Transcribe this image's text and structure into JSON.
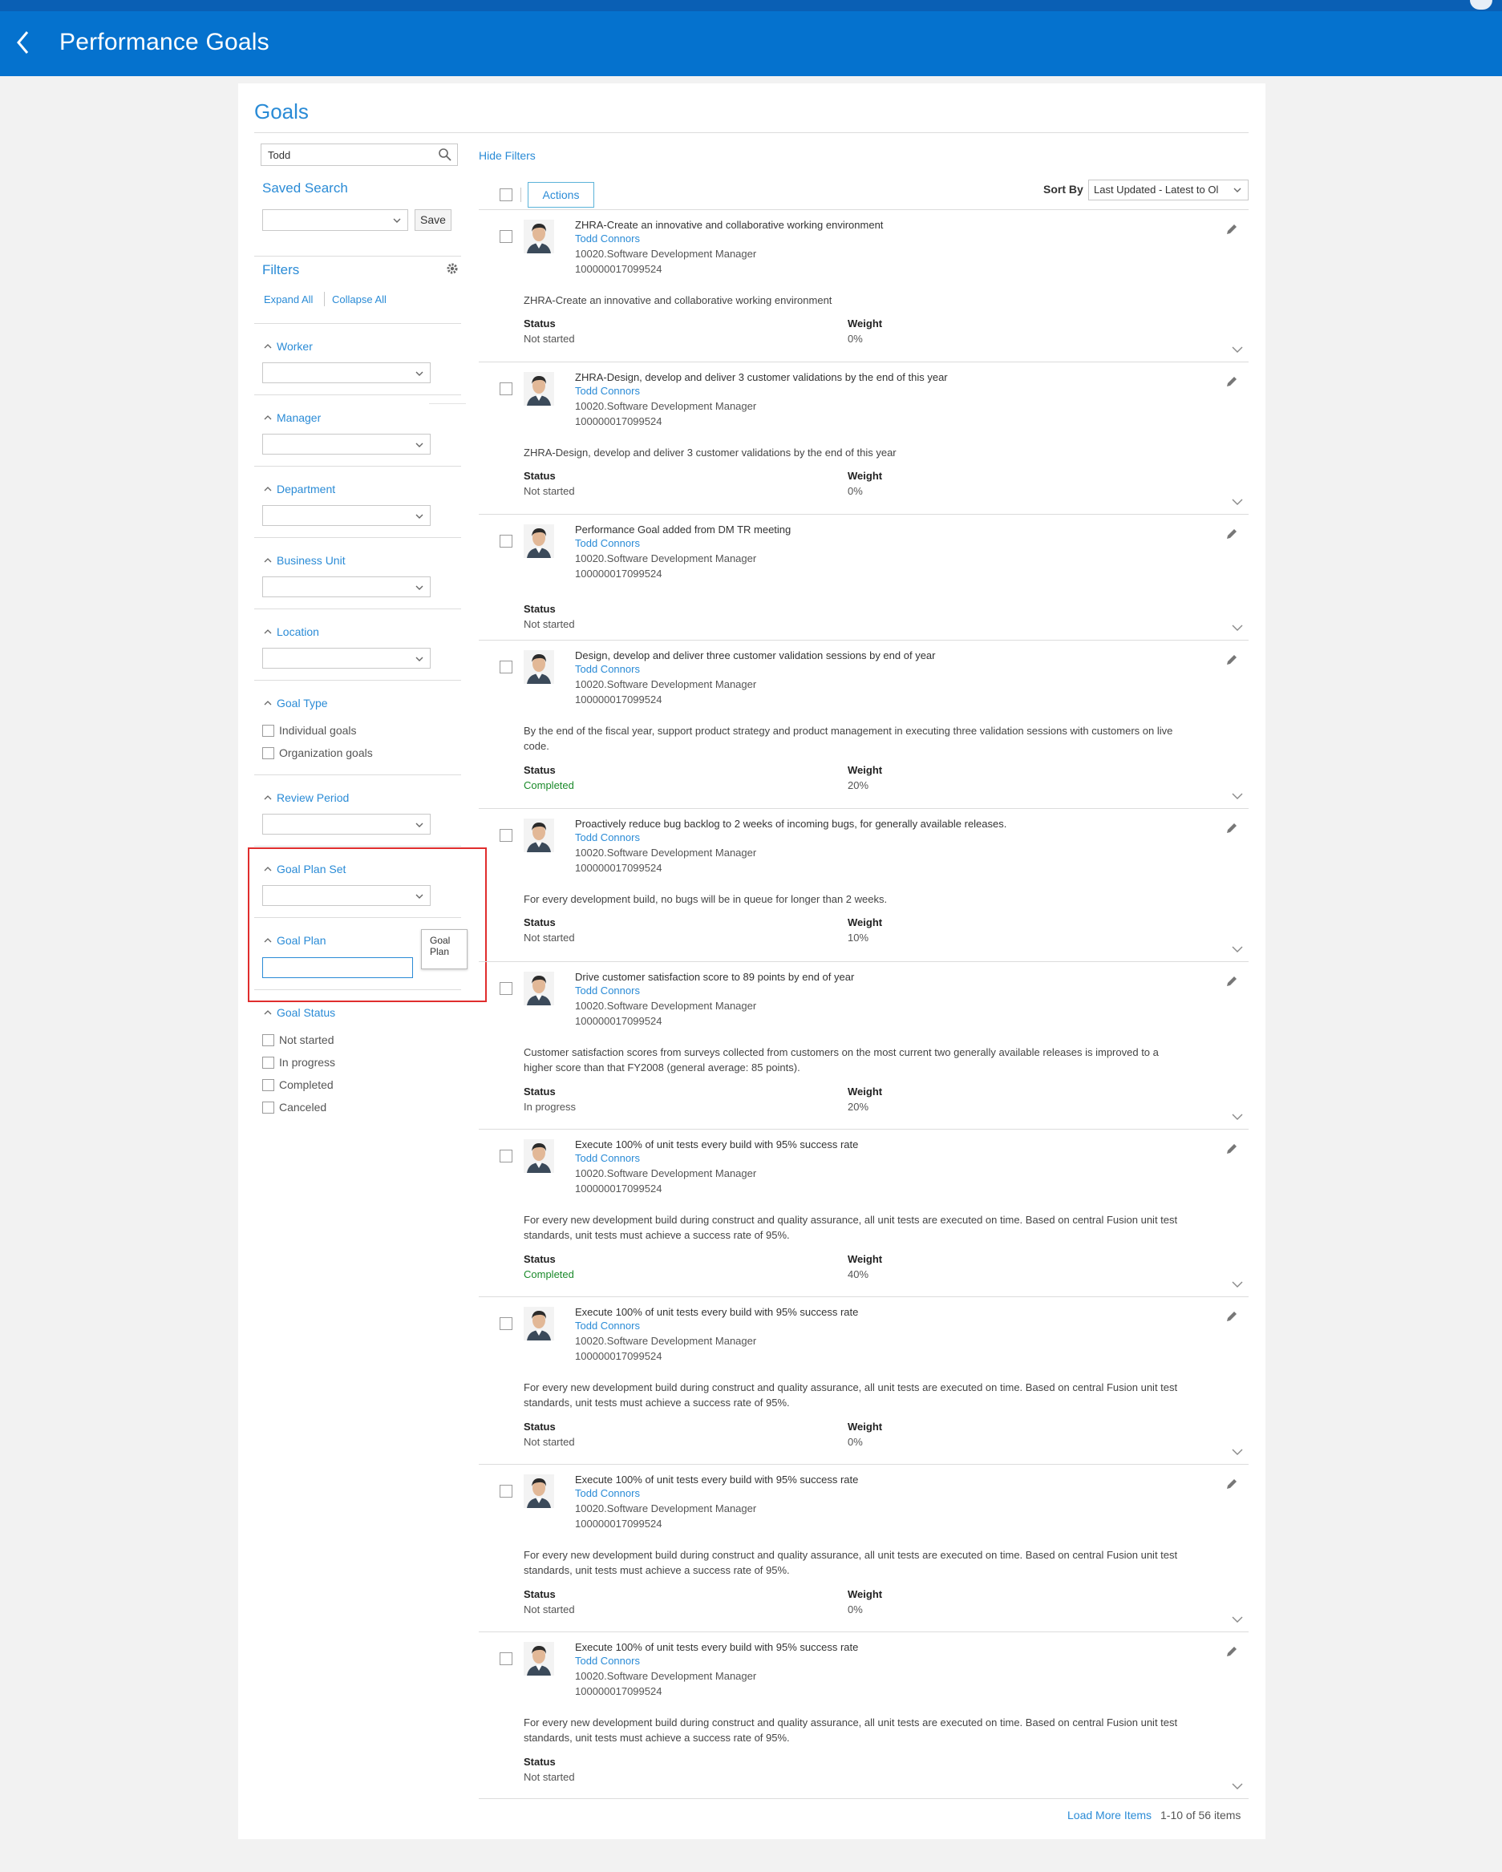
{
  "header": {
    "title": "Performance Goals"
  },
  "panel": {
    "title": "Goals"
  },
  "search": {
    "value": "Todd"
  },
  "saved_search": {
    "title": "Saved Search",
    "save_label": "Save"
  },
  "filters": {
    "title": "Filters",
    "expand_all": "Expand All",
    "collapse_all": "Collapse All",
    "sections": {
      "worker": "Worker",
      "manager": "Manager",
      "department": "Department",
      "business_unit": "Business Unit",
      "location": "Location",
      "goal_type": "Goal Type",
      "review_period": "Review Period",
      "goal_plan_set": "Goal Plan Set",
      "goal_plan": "Goal Plan",
      "goal_status": "Goal Status"
    },
    "goal_type_options": [
      "Individual goals",
      "Organization goals"
    ],
    "goal_status_options": [
      "Not started",
      "In progress",
      "Completed",
      "Canceled"
    ],
    "tooltip": "Goal Plan"
  },
  "results": {
    "hide_filters": "Hide Filters",
    "actions_label": "Actions",
    "sort_by_label": "Sort By",
    "sort_by_value": "Last Updated - Latest to Ol",
    "load_more": "Load More Items",
    "count": "1-10 of 56 items"
  },
  "labels": {
    "status": "Status",
    "weight": "Weight"
  },
  "colors": {
    "header": "#0572ce",
    "link": "#2a8bd6",
    "completed": "#1a8a2a",
    "highlight": "#e02d2d"
  },
  "goals": [
    {
      "title": "ZHRA-Create an innovative and collaborative working environment",
      "worker": "Todd Connors",
      "role": "10020.Software Development Manager",
      "id": "100000017099524",
      "desc": "ZHRA-Create an innovative and collaborative working environment",
      "status": "Not started",
      "weight": "0%"
    },
    {
      "title": "ZHRA-Design, develop and deliver 3 customer validations by the end of this year",
      "worker": "Todd Connors",
      "role": "10020.Software Development Manager",
      "id": "100000017099524",
      "desc": "ZHRA-Design, develop and deliver 3 customer validations by the end of this year",
      "status": "Not started",
      "weight": "0%"
    },
    {
      "title": "Performance Goal added from DM TR meeting",
      "worker": "Todd Connors",
      "role": "10020.Software Development Manager",
      "id": "100000017099524",
      "desc": "",
      "status": "Not started",
      "weight": ""
    },
    {
      "title": "Design, develop and deliver three customer validation sessions by end of year",
      "worker": "Todd Connors",
      "role": "10020.Software Development Manager",
      "id": "100000017099524",
      "desc": "By the end of the fiscal year, support product strategy and product management in executing three validation sessions with customers on live code.",
      "status": "Completed",
      "weight": "20%"
    },
    {
      "title": "Proactively reduce bug backlog to 2 weeks of incoming bugs, for generally available releases.",
      "worker": "Todd Connors",
      "role": "10020.Software Development Manager",
      "id": "100000017099524",
      "desc": "For every development build, no bugs will be in queue for longer than 2 weeks.",
      "status": "Not started",
      "weight": "10%"
    },
    {
      "title": "Drive customer satisfaction score to 89 points by end of year",
      "worker": "Todd Connors",
      "role": "10020.Software Development Manager",
      "id": "100000017099524",
      "desc": "Customer satisfaction scores from surveys collected from customers on the most current two generally available releases is improved to a higher score than that FY2008 (general average: 85 points).",
      "status": "In progress",
      "weight": "20%"
    },
    {
      "title": "Execute 100% of unit tests every build with 95% success rate",
      "worker": "Todd Connors",
      "role": "10020.Software Development Manager",
      "id": "100000017099524",
      "desc": "For every new development build during construct and quality assurance, all unit tests are executed on time. Based on central Fusion unit test standards, unit tests must achieve a success rate of 95%.",
      "status": "Completed",
      "weight": "40%"
    },
    {
      "title": "Execute 100% of unit tests every build with 95% success rate",
      "worker": "Todd Connors",
      "role": "10020.Software Development Manager",
      "id": "100000017099524",
      "desc": "For every new development build during construct and quality assurance, all unit tests are executed on time. Based on central Fusion unit test standards, unit tests must achieve a success rate of 95%.",
      "status": "Not started",
      "weight": "0%"
    },
    {
      "title": "Execute 100% of unit tests every build with 95% success rate",
      "worker": "Todd Connors",
      "role": "10020.Software Development Manager",
      "id": "100000017099524",
      "desc": "For every new development build during construct and quality assurance, all unit tests are executed on time. Based on central Fusion unit test standards, unit tests must achieve a success rate of 95%.",
      "status": "Not started",
      "weight": "0%"
    },
    {
      "title": "Execute 100% of unit tests every build with 95% success rate",
      "worker": "Todd Connors",
      "role": "10020.Software Development Manager",
      "id": "100000017099524",
      "desc": "For every new development build during construct and quality assurance, all unit tests are executed on time. Based on central Fusion unit test standards, unit tests must achieve a success rate of 95%.",
      "status": "Not started",
      "weight": ""
    }
  ]
}
